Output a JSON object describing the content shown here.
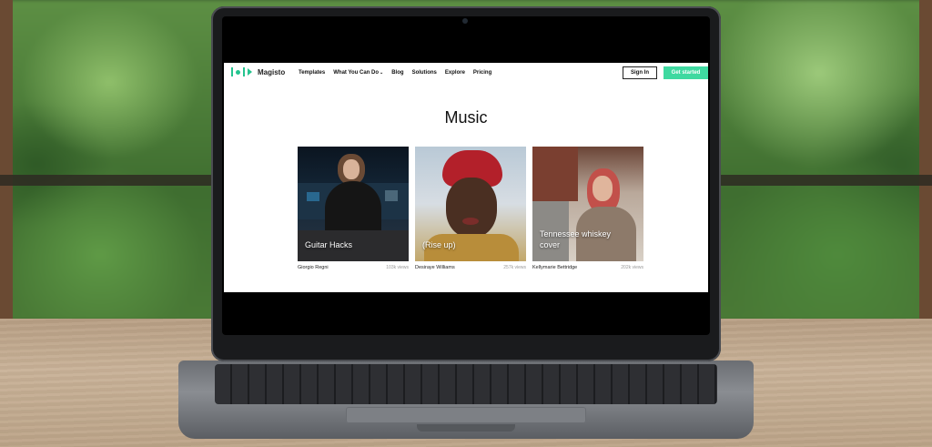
{
  "site": {
    "brand": "Magisto",
    "brand_color": "#25c48f",
    "nav": [
      {
        "label": "Templates",
        "dropdown": false
      },
      {
        "label": "What You Can Do",
        "dropdown": true
      },
      {
        "label": "Blog",
        "dropdown": false
      },
      {
        "label": "Solutions",
        "dropdown": false
      },
      {
        "label": "Explore",
        "dropdown": false
      },
      {
        "label": "Pricing",
        "dropdown": false
      }
    ],
    "signin_label": "Sign In",
    "getstarted_label": "Get started",
    "getstarted_color": "#3fd9a0"
  },
  "page": {
    "title": "Music"
  },
  "videos": [
    {
      "title": "Guitar Hacks",
      "author": "Giorgio Regni",
      "views": "103k views"
    },
    {
      "title": "(Rise up)",
      "author": "Desiraye Williams",
      "views": "257k views"
    },
    {
      "title": "Tennessee whiskey cover",
      "author": "Kellymarie Bettridge",
      "views": "202k views"
    }
  ],
  "icons": {
    "dropdown": "chevron-down-icon",
    "logo": "magisto-logo-icon"
  }
}
